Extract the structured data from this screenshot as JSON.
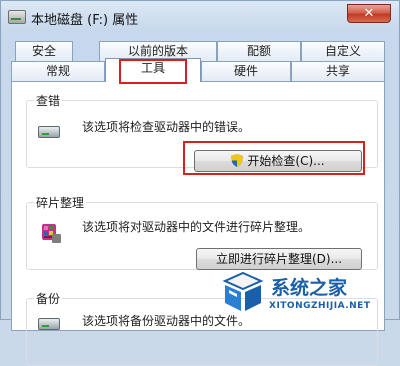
{
  "window": {
    "title": "本地磁盘 (F:) 属性",
    "close_glyph": "✕"
  },
  "tabs_back": [
    {
      "label": "安全"
    },
    {
      "label": "以前的版本"
    },
    {
      "label": "配额"
    },
    {
      "label": "自定义"
    }
  ],
  "tabs_front": [
    {
      "label": "常规"
    },
    {
      "label": "工具",
      "active": true
    },
    {
      "label": "硬件"
    },
    {
      "label": "共享"
    }
  ],
  "error_check": {
    "title": "查错",
    "description": "该选项将检查驱动器中的错误。",
    "button_label": "开始检查(C)...",
    "icon": "drive-icon"
  },
  "defrag": {
    "title": "碎片整理",
    "description": "该选项将对驱动器中的文件进行碎片整理。",
    "button_label": "立即进行碎片整理(D)...",
    "icon": "defrag-icon"
  },
  "backup": {
    "title": "备份",
    "description": "该选项将备份驱动器中的文件。",
    "icon": "backup-drive-icon"
  },
  "watermark": {
    "brand": "系统之家",
    "url": "XITONGZHIJIA.NET"
  },
  "colors": {
    "highlight": "#d91f1f",
    "titlebar": "#c9d9ea",
    "close": "#c13b24"
  }
}
